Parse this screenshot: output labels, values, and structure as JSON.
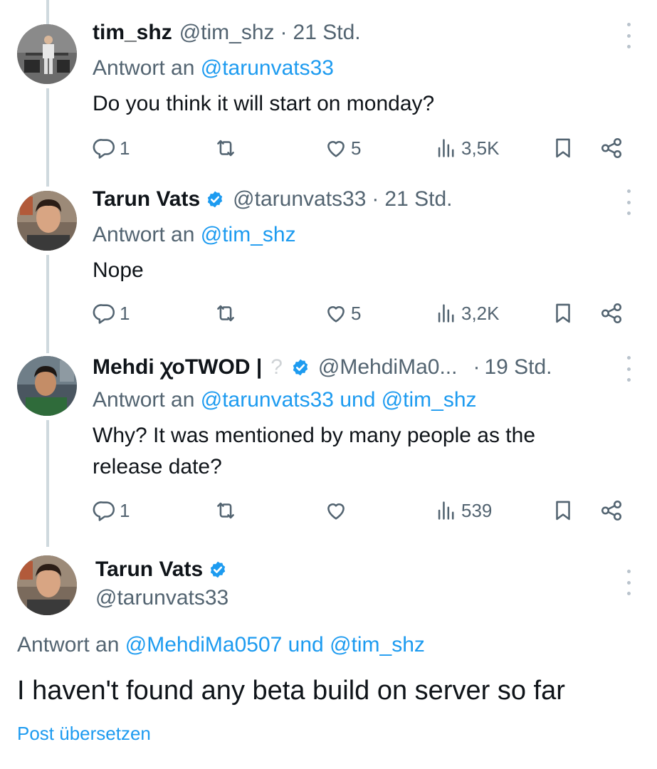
{
  "tweets": [
    {
      "name": "tim_shz",
      "handle": "@tim_shz",
      "sep": "·",
      "time": "21 Std.",
      "reply_prefix": "Antwort an",
      "reply_mentions": "@tarunvats33",
      "text": "Do you think it will start on monday?",
      "replies": "1",
      "likes": "5",
      "views": "3,5K"
    },
    {
      "name": "Tarun Vats",
      "handle": "@tarunvats33",
      "sep": "·",
      "time": "21 Std.",
      "reply_prefix": "Antwort an",
      "reply_mentions": "@tim_shz",
      "text": "Nope",
      "replies": "1",
      "likes": "5",
      "views": "3,2K"
    },
    {
      "name": "Mehdi ꭓoTWOD |",
      "handle": "@MehdiMa0...",
      "sep": "·",
      "time": "19 Std.",
      "reply_prefix": "Antwort an",
      "reply_mentions": "@tarunvats33 und @tim_shz",
      "text": "Why? It was mentioned by many people as the release date?",
      "replies": "1",
      "likes": "",
      "views": "539"
    }
  ],
  "main": {
    "name": "Tarun Vats",
    "handle": "@tarunvats33",
    "reply_prefix": "Antwort an",
    "reply_mentions": "@MehdiMa0507 und @tim_shz",
    "text": "I haven't found any beta build on server so far",
    "translate": "Post übersetzen"
  },
  "icons": {
    "more": "more-vertical-icon",
    "reply": "reply-icon",
    "retweet": "retweet-icon",
    "like": "heart-icon",
    "views": "views-icon",
    "bookmark": "bookmark-icon",
    "share": "share-icon",
    "verified": "verified-badge-icon",
    "unknown_emoji": "question-mark-emoji-icon"
  },
  "colors": {
    "accent": "#1d9bf0",
    "muted": "#536471",
    "text": "#0f1419",
    "thread": "#cfd9de"
  }
}
